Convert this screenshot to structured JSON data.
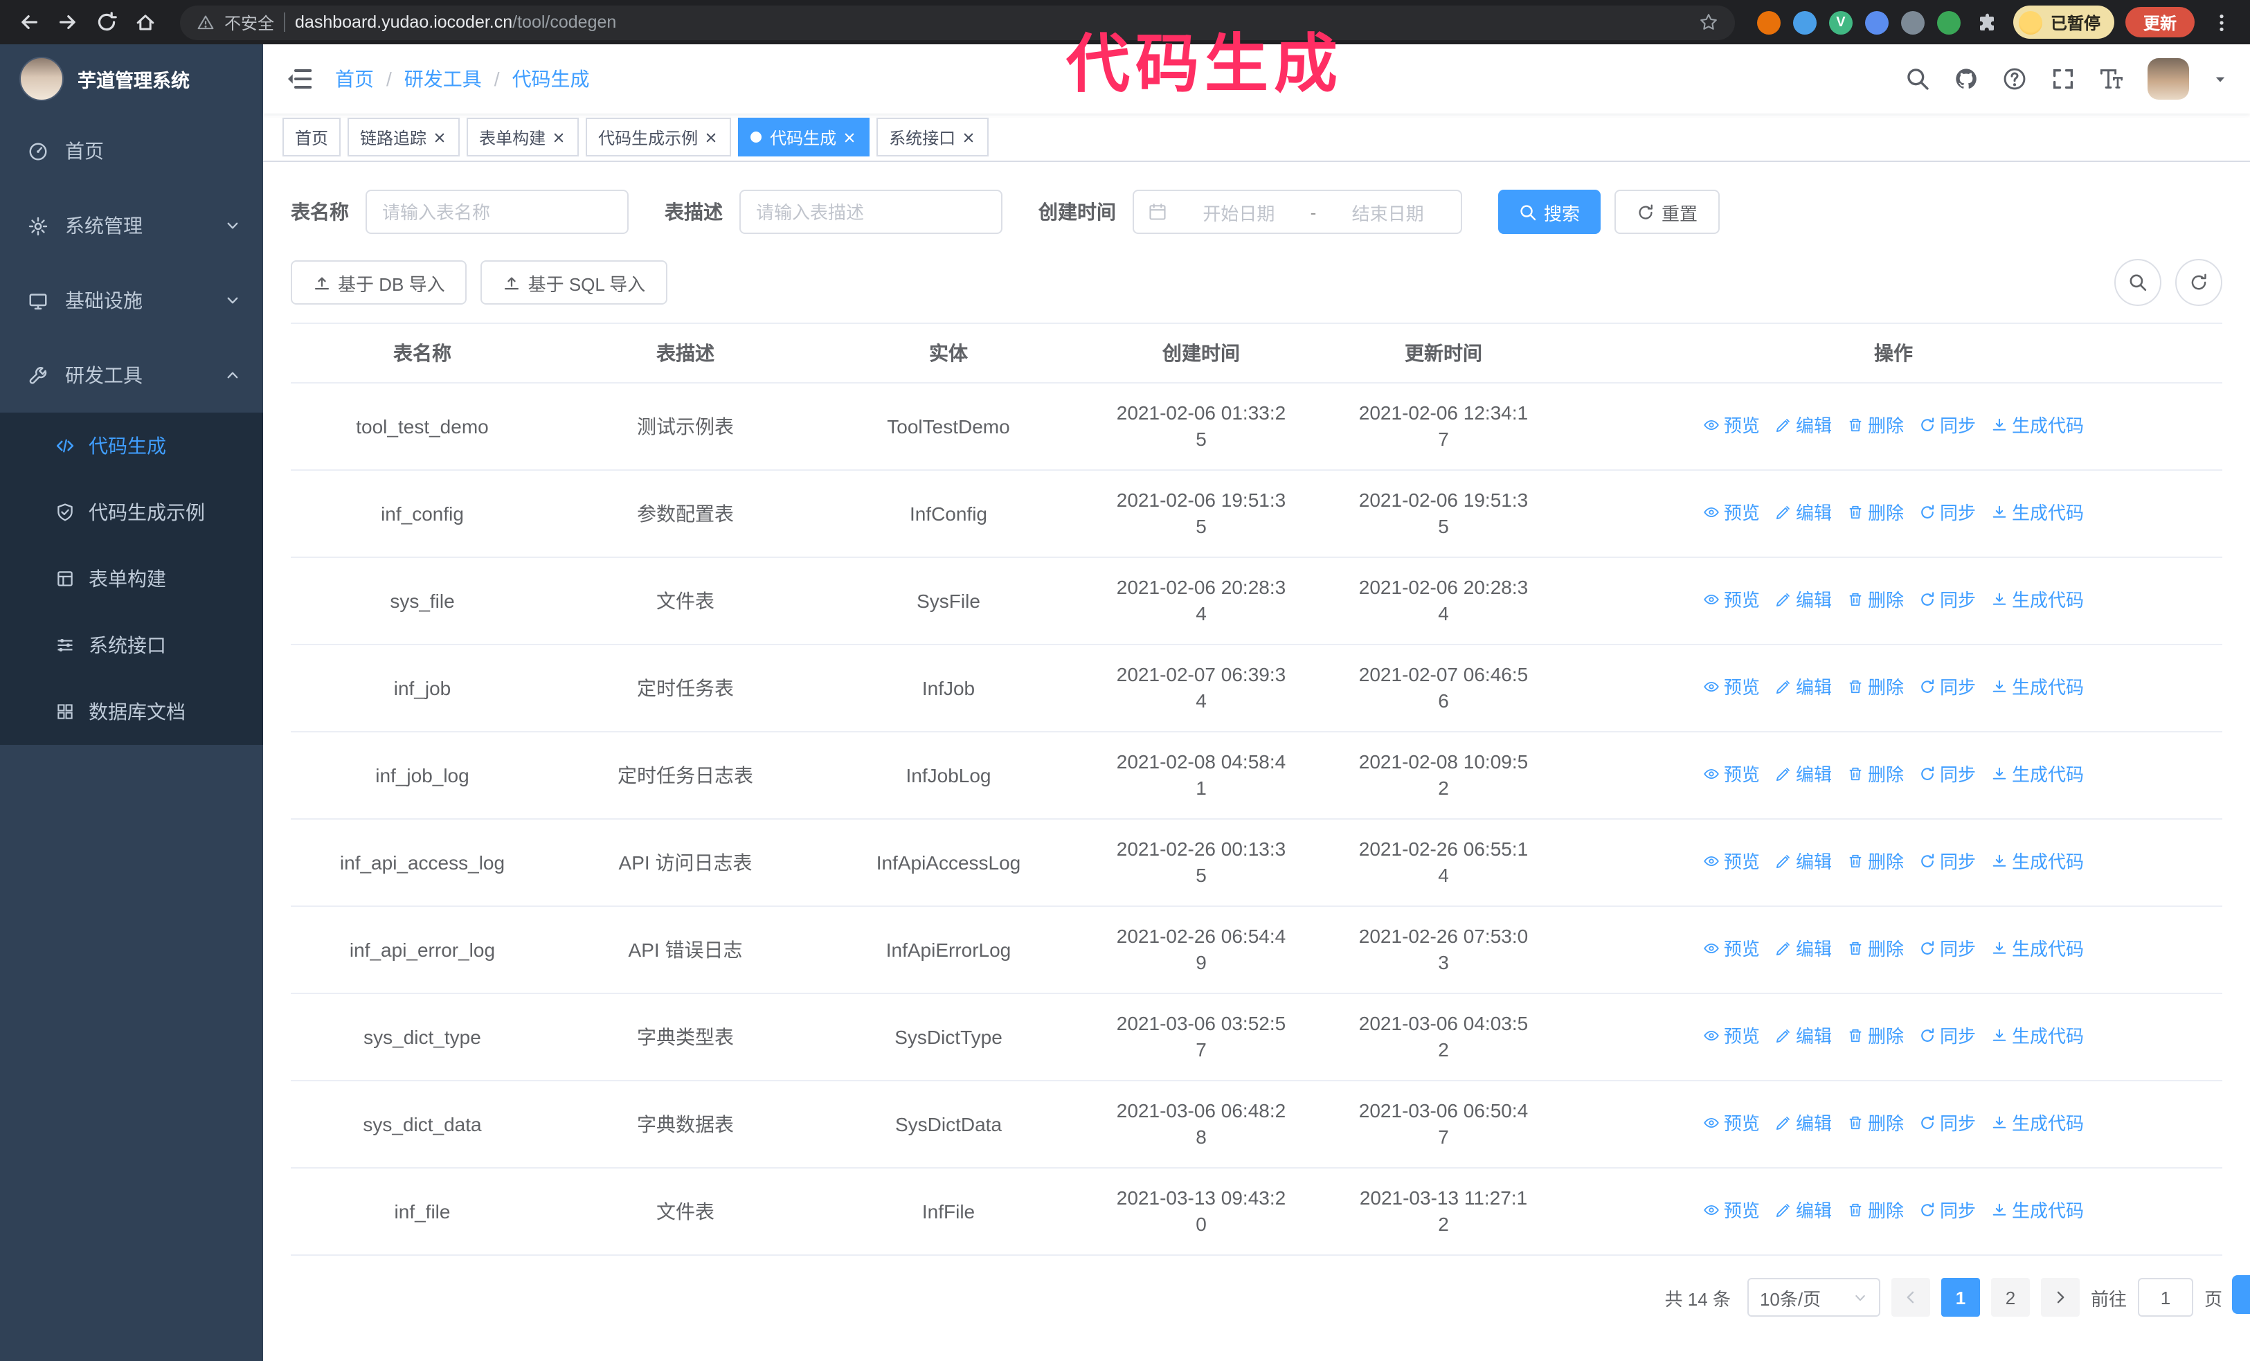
{
  "annotation": {
    "text": "代码生成",
    "color": "#ff2e63"
  },
  "browser": {
    "security_label": "不安全",
    "url_host": "dashboard.yudao.iocoder.cn",
    "url_path": "/tool/codegen",
    "profile_label": "已暂停",
    "update_label": "更新",
    "extensions": [
      {
        "name": "orange-extension-icon",
        "color": "#e8710a"
      },
      {
        "name": "blue-drop-extension-icon",
        "color": "#4a9fe8"
      },
      {
        "name": "vue-devtools-extension-icon",
        "color": "#41b883",
        "glyph": "V"
      },
      {
        "name": "people-extension-icon",
        "color": "#5b8def"
      },
      {
        "name": "screenshot-extension-icon",
        "color": "#7d8a96"
      },
      {
        "name": "leaf-extension-icon",
        "color": "#3aa757"
      }
    ]
  },
  "sidebar": {
    "logo_title": "芋道管理系统",
    "items": [
      {
        "label": "首页"
      },
      {
        "label": "系统管理"
      },
      {
        "label": "基础设施"
      },
      {
        "label": "研发工具",
        "children": [
          {
            "label": "代码生成",
            "active": true
          },
          {
            "label": "代码生成示例"
          },
          {
            "label": "表单构建"
          },
          {
            "label": "系统接口"
          },
          {
            "label": "数据库文档"
          }
        ]
      }
    ]
  },
  "header": {
    "breadcrumb": [
      "首页",
      "研发工具",
      "代码生成"
    ]
  },
  "tabs": [
    {
      "label": "首页",
      "closable": false,
      "active": false
    },
    {
      "label": "链路追踪",
      "closable": true,
      "active": false
    },
    {
      "label": "表单构建",
      "closable": true,
      "active": false
    },
    {
      "label": "代码生成示例",
      "closable": true,
      "active": false
    },
    {
      "label": "代码生成",
      "closable": true,
      "active": true
    },
    {
      "label": "系统接口",
      "closable": true,
      "active": false
    }
  ],
  "filters": {
    "table_name_label": "表名称",
    "table_name_placeholder": "请输入表名称",
    "table_desc_label": "表描述",
    "table_desc_placeholder": "请输入表描述",
    "create_time_label": "创建时间",
    "date_start_placeholder": "开始日期",
    "date_separator": "-",
    "date_end_placeholder": "结束日期",
    "search_label": "搜索",
    "reset_label": "重置"
  },
  "toolbar": {
    "import_db_label": "基于 DB 导入",
    "import_sql_label": "基于 SQL 导入"
  },
  "table": {
    "columns": [
      "表名称",
      "表描述",
      "实体",
      "创建时间",
      "更新时间",
      "操作"
    ],
    "row_actions": [
      {
        "label": "预览",
        "icon": "eye-icon"
      },
      {
        "label": "编辑",
        "icon": "pencil-icon"
      },
      {
        "label": "删除",
        "icon": "trash-icon"
      },
      {
        "label": "同步",
        "icon": "sync-icon"
      },
      {
        "label": "生成代码",
        "icon": "download-icon"
      }
    ],
    "rows": [
      {
        "name": "tool_test_demo",
        "desc": "测试示例表",
        "entity": "ToolTestDemo",
        "create_time": "2021-02-06 01:33:25",
        "update_time": "2021-02-06 12:34:17"
      },
      {
        "name": "inf_config",
        "desc": "参数配置表",
        "entity": "InfConfig",
        "create_time": "2021-02-06 19:51:35",
        "update_time": "2021-02-06 19:51:35"
      },
      {
        "name": "sys_file",
        "desc": "文件表",
        "entity": "SysFile",
        "create_time": "2021-02-06 20:28:34",
        "update_time": "2021-02-06 20:28:34"
      },
      {
        "name": "inf_job",
        "desc": "定时任务表",
        "entity": "InfJob",
        "create_time": "2021-02-07 06:39:34",
        "update_time": "2021-02-07 06:46:56"
      },
      {
        "name": "inf_job_log",
        "desc": "定时任务日志表",
        "entity": "InfJobLog",
        "create_time": "2021-02-08 04:58:41",
        "update_time": "2021-02-08 10:09:52"
      },
      {
        "name": "inf_api_access_log",
        "desc": "API 访问日志表",
        "entity": "InfApiAccessLog",
        "create_time": "2021-02-26 00:13:35",
        "update_time": "2021-02-26 06:55:14"
      },
      {
        "name": "inf_api_error_log",
        "desc": "API 错误日志",
        "entity": "InfApiErrorLog",
        "create_time": "2021-02-26 06:54:49",
        "update_time": "2021-02-26 07:53:03"
      },
      {
        "name": "sys_dict_type",
        "desc": "字典类型表",
        "entity": "SysDictType",
        "create_time": "2021-03-06 03:52:57",
        "update_time": "2021-03-06 04:03:52"
      },
      {
        "name": "sys_dict_data",
        "desc": "字典数据表",
        "entity": "SysDictData",
        "create_time": "2021-03-06 06:48:28",
        "update_time": "2021-03-06 06:50:47"
      },
      {
        "name": "inf_file",
        "desc": "文件表",
        "entity": "InfFile",
        "create_time": "2021-03-13 09:43:20",
        "update_time": "2021-03-13 11:27:12"
      }
    ]
  },
  "pagination": {
    "total_label": "共 14 条",
    "page_size_label": "10条/页",
    "pages": [
      "1",
      "2"
    ],
    "active_page": "1",
    "goto_label": "前往",
    "goto_value": "1",
    "page_unit_label": "页"
  },
  "colors": {
    "primary": "#409eff",
    "sidebar_bg": "#304156",
    "submenu_bg": "#1f2d3d",
    "annotation": "#ff2e63"
  }
}
